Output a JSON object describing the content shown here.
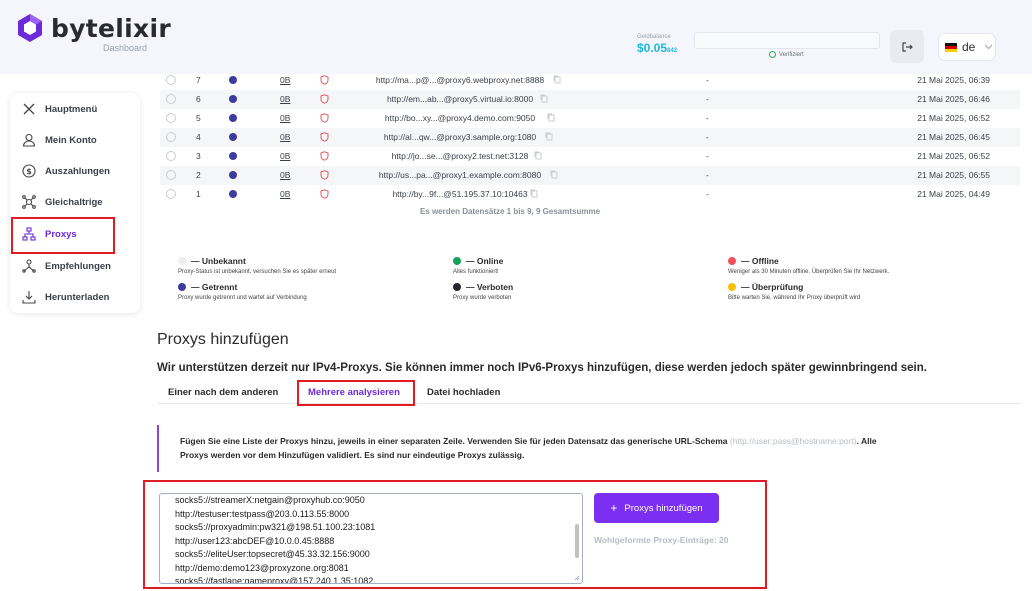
{
  "header": {
    "logo_text": "bytelixir",
    "logo_sub": "Dashboard",
    "balance_label": "Geldbalance",
    "balance_value": "$0.05",
    "balance_suffix": "842",
    "verified": "Verifiziert",
    "language": "de"
  },
  "sidebar": {
    "items": [
      {
        "label": "Hauptmenü",
        "icon": "close-icon"
      },
      {
        "label": "Mein Konto",
        "icon": "user-icon"
      },
      {
        "label": "Auszahlungen",
        "icon": "dollar-icon"
      },
      {
        "label": "Gleichaltrige",
        "icon": "peers-icon"
      },
      {
        "label": "Proxys",
        "icon": "network-icon"
      },
      {
        "label": "Empfehlungen",
        "icon": "referral-icon"
      },
      {
        "label": "Herunterladen",
        "icon": "download-icon"
      }
    ]
  },
  "table": {
    "rows": [
      {
        "id": "7",
        "traffic": "0B",
        "url": "http://ma...p@...@proxy6.webproxy.net:8888",
        "dash": "-",
        "date": "21 Mai 2025, 06:39"
      },
      {
        "id": "6",
        "traffic": "0B",
        "url": "http://em...ab...@proxy5.virtual.io:8000",
        "dash": "-",
        "date": "21 Mai 2025, 06:46"
      },
      {
        "id": "5",
        "traffic": "0B",
        "url": "http://bo...xy...@proxy4.demo.com:9050",
        "dash": "-",
        "date": "21 Mai 2025, 06:52"
      },
      {
        "id": "4",
        "traffic": "0B",
        "url": "http://al...qw...@proxy3.sample.org:1080",
        "dash": "-",
        "date": "21 Mai 2025, 06:45"
      },
      {
        "id": "3",
        "traffic": "0B",
        "url": "http://jo...se...@proxy2.test.net:3128",
        "dash": "-",
        "date": "21 Mai 2025, 06:52"
      },
      {
        "id": "2",
        "traffic": "0B",
        "url": "http://us...pa...@proxy1.example.com:8080",
        "dash": "-",
        "date": "21 Mai 2025, 06:55"
      },
      {
        "id": "1",
        "traffic": "0B",
        "url": "http://by...9f...@51.195.37.10:10463",
        "dash": "-",
        "date": "21 Mai 2025, 04:49"
      }
    ],
    "summary": "Es werden Datensätze 1 bis 9, 9 Gesamtsumme"
  },
  "legend": [
    {
      "title": "— Unbekannt",
      "desc": "Proxy-Status ist unbekannt, versuchen Sie es später erneut",
      "color": "#eeeeee"
    },
    {
      "title": "— Online",
      "desc": "Alles funktioniert!",
      "color": "#16a05d"
    },
    {
      "title": "— Offline",
      "desc": "Weniger als 30 Minuten offline. Überprüfen Sie Ihr Netzwerk.",
      "color": "#f0505a"
    },
    {
      "title": "— Getrennt",
      "desc": "Proxy wurde getrennt und wartet auf Verbindung",
      "color": "#3c3c9e"
    },
    {
      "title": "— Verboten",
      "desc": "Proxy wurde verboten",
      "color": "#26262e"
    },
    {
      "title": "— Überprüfung",
      "desc": "Bitte warten Sie, während Ihr Proxy überprüft wird",
      "color": "#f5c000"
    }
  ],
  "add": {
    "title": "Proxys hinzufügen",
    "subtitle": "Wir unterstützen derzeit nur IPv4-Proxys. Sie können immer noch IPv6-Proxys hinzufügen, diese werden jedoch später gewinnbringend sein.",
    "tabs": [
      "Einer nach dem anderen",
      "Mehrere analysieren",
      "Datei hochladen"
    ],
    "info_line1": "Fügen Sie eine Liste der Proxys hinzu, jeweils in einer separaten Zeile. Verwenden Sie für jeden Datensatz das generische URL-Schema",
    "info_hint": "(http://user:pass@hostname:port)",
    "info_line1_end": ". Alle",
    "info_line2": "Proxys werden vor dem Hinzufügen validiert. Es sind nur eindeutige Proxys zulässig.",
    "textarea_lines": [
      "socks5://streamerX:netgain@proxyhub.co:9050",
      "http://testuser:testpass@203.0.113.55:8000",
      "socks5://proxyadmin:pw321@198.51.100.23:1081",
      "http://user123:abcDEF@10.0.0.45:8888",
      "socks5://eliteUser:topsecret@45.33.32.156:9000",
      "http://demo:demo123@proxyzone.org:8081",
      "socks5://fastlane:gameproxy@157.240.1.35:1082"
    ],
    "button": "Proxys hinzufügen",
    "wellformed": "Wohlgeformte Proxy-Einträge: 20"
  }
}
